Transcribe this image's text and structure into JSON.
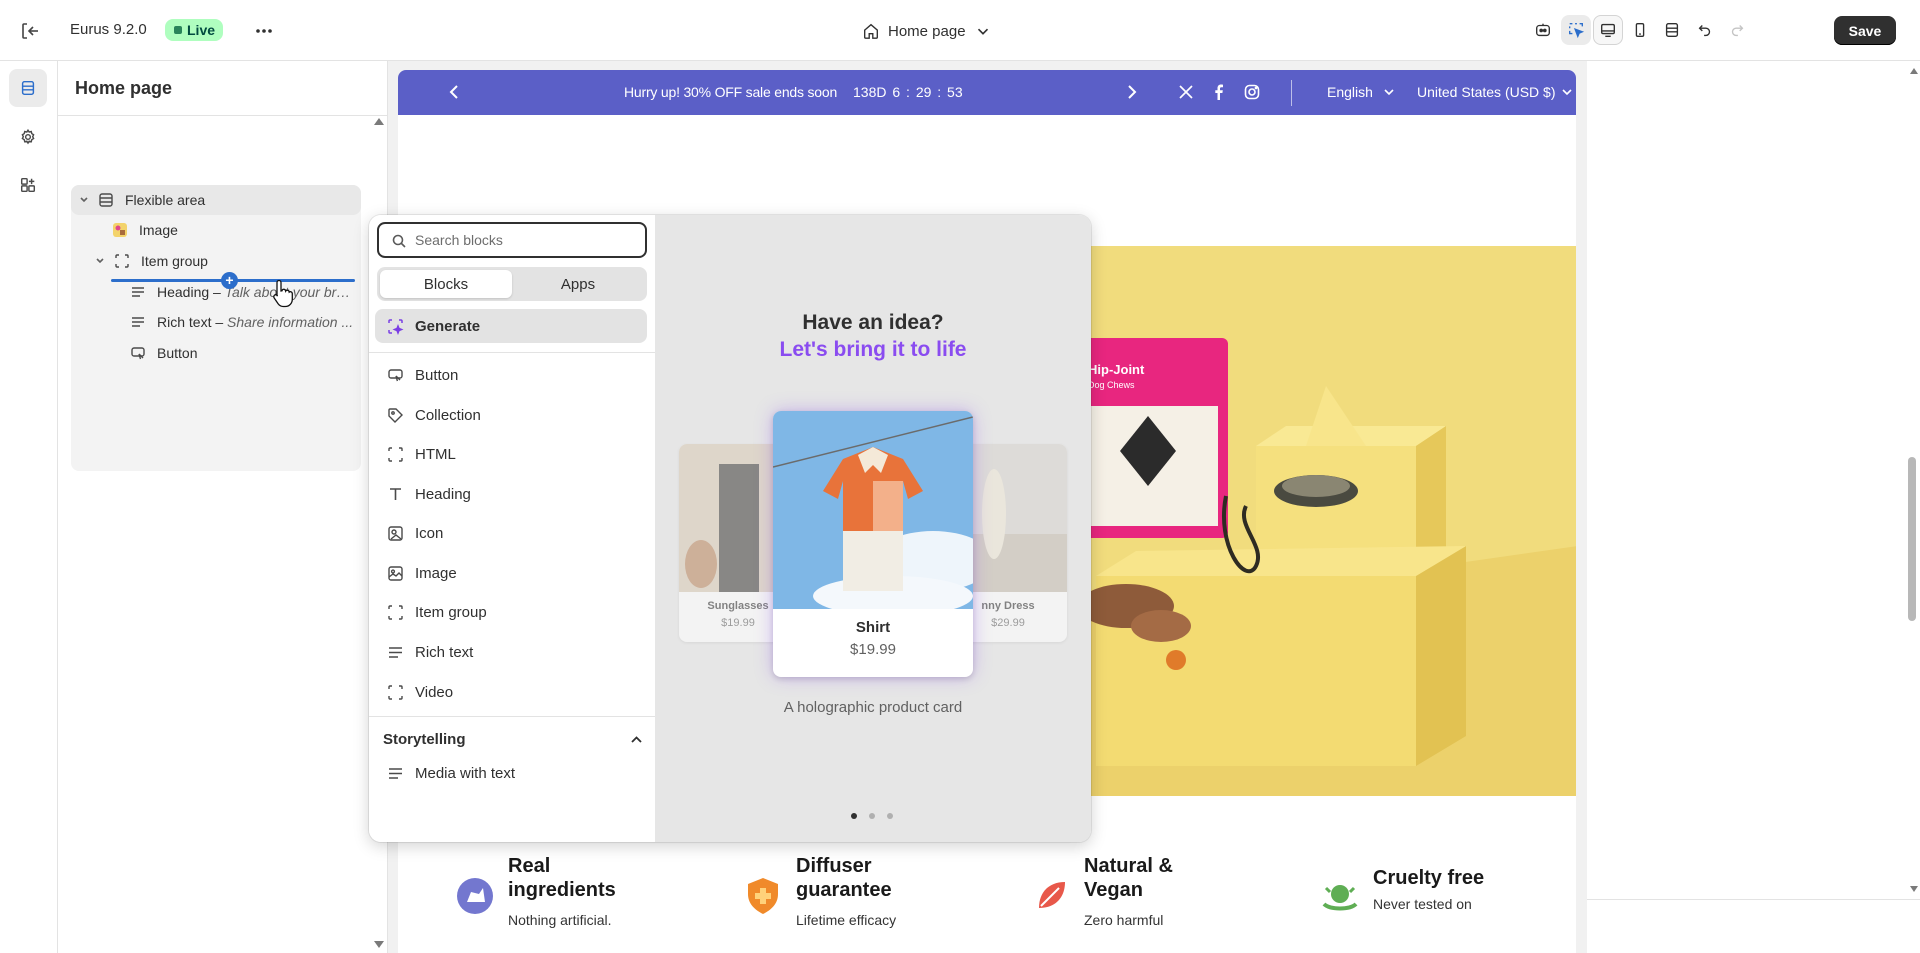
{
  "topbar": {
    "theme_name": "Eurus 9.2.0",
    "status_badge": "Live",
    "page_selector": "Home page",
    "save_label": "Save"
  },
  "sidebar": {
    "title": "Home page",
    "tree": {
      "section": "Flexible area",
      "image": "Image",
      "group": "Item group",
      "heading_label": "Heading",
      "heading_desc": "Talk about your bra...",
      "rich_label": "Rich text",
      "rich_desc": "Share information ...",
      "button": "Button"
    },
    "sep": "–"
  },
  "announcement": {
    "message": "Hurry up! 30% OFF sale ends soon",
    "timer": "138D  6 : 29 : 53",
    "language": "English",
    "currency": "United States (USD $)"
  },
  "features": [
    {
      "title": "Real ingredients",
      "body": "Nothing artificial."
    },
    {
      "title": "Diffuser guarantee",
      "body": "Lifetime efficacy"
    },
    {
      "title": "Natural & Vegan",
      "body": "Zero harmful"
    },
    {
      "title": "Cruelty free",
      "body": "Never tested on"
    }
  ],
  "picker": {
    "search_placeholder": "Search blocks",
    "tabs": [
      "Blocks",
      "Apps"
    ],
    "generate": "Generate",
    "items": [
      "Button",
      "Collection",
      "HTML",
      "Heading",
      "Icon",
      "Image",
      "Item group",
      "Rich text",
      "Video"
    ],
    "category": "Storytelling",
    "category_items": [
      "Media with text"
    ],
    "preview": {
      "headline": "Have an idea?",
      "subheadline": "Let's bring it to life",
      "caption": "A holographic product card",
      "cards": [
        {
          "name": "Sunglasses",
          "price": "$19.99"
        },
        {
          "name": "Shirt",
          "price": "$19.99"
        },
        {
          "name": "nny Dress",
          "price": "$29.99"
        }
      ],
      "active_dot": 0,
      "dot_count": 3
    }
  },
  "hero": {
    "package_brand": "Hip-Joint",
    "package_sub": "Dog Chews"
  },
  "colors": {
    "accent_blue": "#2c6ecb",
    "announcement_bg": "#5b5fc7",
    "live_bg": "#affebf",
    "generate_purple": "#8a4cf0",
    "hero_yellow": "#f1dc7d"
  }
}
